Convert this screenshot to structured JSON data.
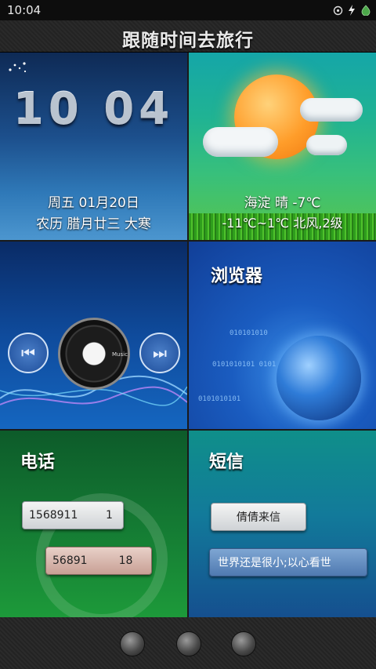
{
  "status_bar": {
    "time": "10:04",
    "icons": [
      "sync-icon",
      "charging-bolt-icon",
      "battery-icon"
    ]
  },
  "header": {
    "title": "跟随时间去旅行"
  },
  "clock_tile": {
    "time_display": "10 04",
    "date": "周五 01月20日",
    "lunar": "农历 腊月廿三 大寒"
  },
  "weather_tile": {
    "line1": "海淀 晴 -7℃",
    "line2": "-11℃~1℃ 北风,2级"
  },
  "music_tile": {
    "disc_label": "Music",
    "icons": [
      "previous-icon",
      "vinyl-disc-icon",
      "next-icon"
    ]
  },
  "browser_tile": {
    "title": "浏览器",
    "icon": "globe-icon"
  },
  "phone_tile": {
    "title": "电话",
    "call1": "1568911        1",
    "call2": "56891         18"
  },
  "sms_tile": {
    "title": "短信",
    "msg_sender": "倩倩来信",
    "msg_preview": "世界还是很小;以心看世"
  },
  "dock": {
    "buttons": [
      "dock-button-left",
      "dock-button-center",
      "dock-button-right"
    ]
  }
}
